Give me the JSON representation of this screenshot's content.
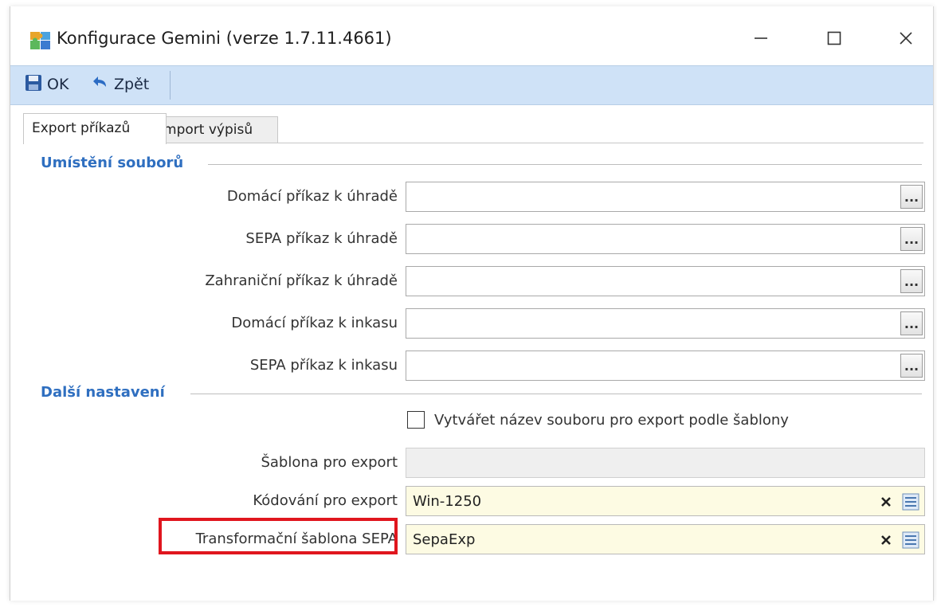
{
  "window": {
    "title": "Konfigurace Gemini (verze 1.7.11.4661)",
    "controls": {
      "minimize": "—",
      "maximize": "☐",
      "close": "✕"
    }
  },
  "toolbar": {
    "ok_label": "OK",
    "back_label": "Zpět"
  },
  "tabs": [
    {
      "label": "Export příkazů",
      "active": true
    },
    {
      "label": "Import výpisů",
      "active": false
    }
  ],
  "sections": {
    "file_location": "Umístění souborů",
    "other_settings": "Další nastavení"
  },
  "file_rows": [
    {
      "label": "Domácí příkaz k úhradě",
      "value": ""
    },
    {
      "label": "SEPA příkaz k úhradě",
      "value": ""
    },
    {
      "label": "Zahraniční příkaz k úhradě",
      "value": ""
    },
    {
      "label": "Domácí příkaz k inkasu",
      "value": ""
    },
    {
      "label": "SEPA příkaz k inkasu",
      "value": ""
    }
  ],
  "browse_label": "...",
  "checkbox": {
    "label": "Vytvářet název souboru pro export podle šablony",
    "checked": false
  },
  "template_row": {
    "label": "Šablona pro export",
    "value": ""
  },
  "encoding_row": {
    "label": "Kódování pro export",
    "value": "Win-1250"
  },
  "sepa_row": {
    "label": "Transformační šablona SEPA",
    "value": "SepaExp"
  },
  "colors": {
    "toolbar_bg": "#cfe2f7",
    "section_title": "#2f6fc0",
    "highlight_border": "#e0161e",
    "combo_bg": "#fdfbe3"
  }
}
